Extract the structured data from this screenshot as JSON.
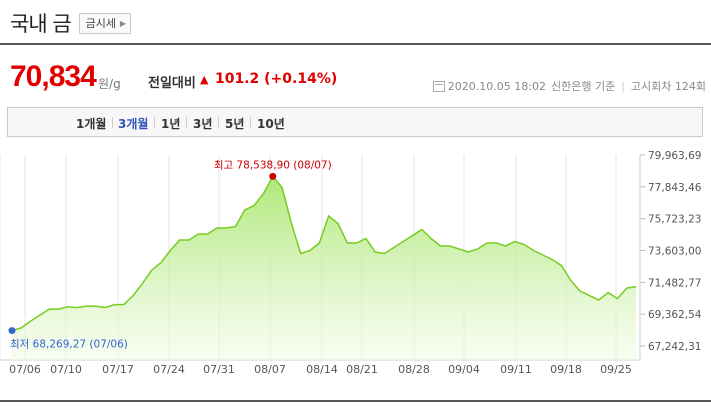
{
  "header": {
    "title": "국내 금",
    "quote_button": "금시세"
  },
  "price": {
    "value": "70,834",
    "unit": "원/g",
    "change_label": "전일대비",
    "change_value": "101.2 (+0.14%)",
    "direction": "up",
    "up_color": "#e00000"
  },
  "info": {
    "datetime": "2020.10.05 18:02",
    "bank": "신한은행 기준",
    "round": "고시회차 124회"
  },
  "tabs": [
    {
      "label": "1개월",
      "active": false
    },
    {
      "label": "3개월",
      "active": true
    },
    {
      "label": "1년",
      "active": false
    },
    {
      "label": "3년",
      "active": false
    },
    {
      "label": "5년",
      "active": false
    },
    {
      "label": "10년",
      "active": false
    }
  ],
  "chart_data": {
    "type": "area",
    "line_color": "#77cc22",
    "fill_color": "#c8f0a0",
    "ylim": [
      67242.31,
      79963.69
    ],
    "ytick_labels": [
      "79,963,69",
      "77,843,46",
      "75,723,23",
      "73,603,00",
      "71,482,77",
      "69,362,54",
      "67,242,31"
    ],
    "xtick_labels": [
      "07/06",
      "07/10",
      "07/17",
      "07/24",
      "07/31",
      "08/07",
      "08/14",
      "08/21",
      "08/28",
      "09/04",
      "09/11",
      "09/18",
      "09/25"
    ],
    "max_label": {
      "text": "최고  78,538,90 (08/07)",
      "value": 78538.9,
      "color": "#cc0000"
    },
    "min_label": {
      "text": "최저  68,269,27 (07/06)",
      "value": 68269.27,
      "color": "#3366cc"
    },
    "x_day_offsets": [
      0,
      1,
      2,
      3,
      4,
      5,
      6,
      7,
      8,
      9,
      10,
      11,
      12,
      13,
      14,
      15,
      16,
      17,
      18,
      19,
      20,
      21,
      22,
      23,
      24,
      25,
      26,
      27,
      28,
      29,
      30,
      31,
      32,
      33,
      34,
      35,
      36,
      37,
      38,
      39,
      40,
      41,
      42,
      43,
      44,
      45,
      46,
      47,
      48,
      49,
      50,
      51,
      52,
      53,
      54,
      55,
      56,
      57,
      58,
      59,
      60,
      61,
      62,
      63,
      64,
      65,
      66,
      67,
      68,
      69,
      70,
      71,
      72,
      73,
      74,
      75,
      76,
      77,
      78,
      79,
      80,
      81,
      82,
      83,
      84,
      85,
      86,
      87,
      88,
      89
    ],
    "values": [
      68269.27,
      68450,
      68900,
      69300,
      69700,
      69700,
      69850,
      69800,
      69900,
      69900,
      69800,
      70000,
      70000,
      70600,
      71400,
      72300,
      72800,
      73600,
      74300,
      74300,
      74700,
      74700,
      75100,
      75100,
      75200,
      76300,
      76600,
      77400,
      78538.9,
      77800,
      75400,
      73400,
      73600,
      74100,
      75900,
      75400,
      74100,
      74100,
      74400,
      73500,
      73400,
      73800,
      74200,
      74600,
      75000,
      74400,
      73900,
      73900,
      73700,
      73500,
      73700,
      74100,
      74100,
      73900,
      74200,
      74000,
      73600,
      73300,
      73000,
      72600,
      71600,
      70900,
      70600,
      70300,
      70800,
      70400,
      71100,
      71200
    ]
  }
}
